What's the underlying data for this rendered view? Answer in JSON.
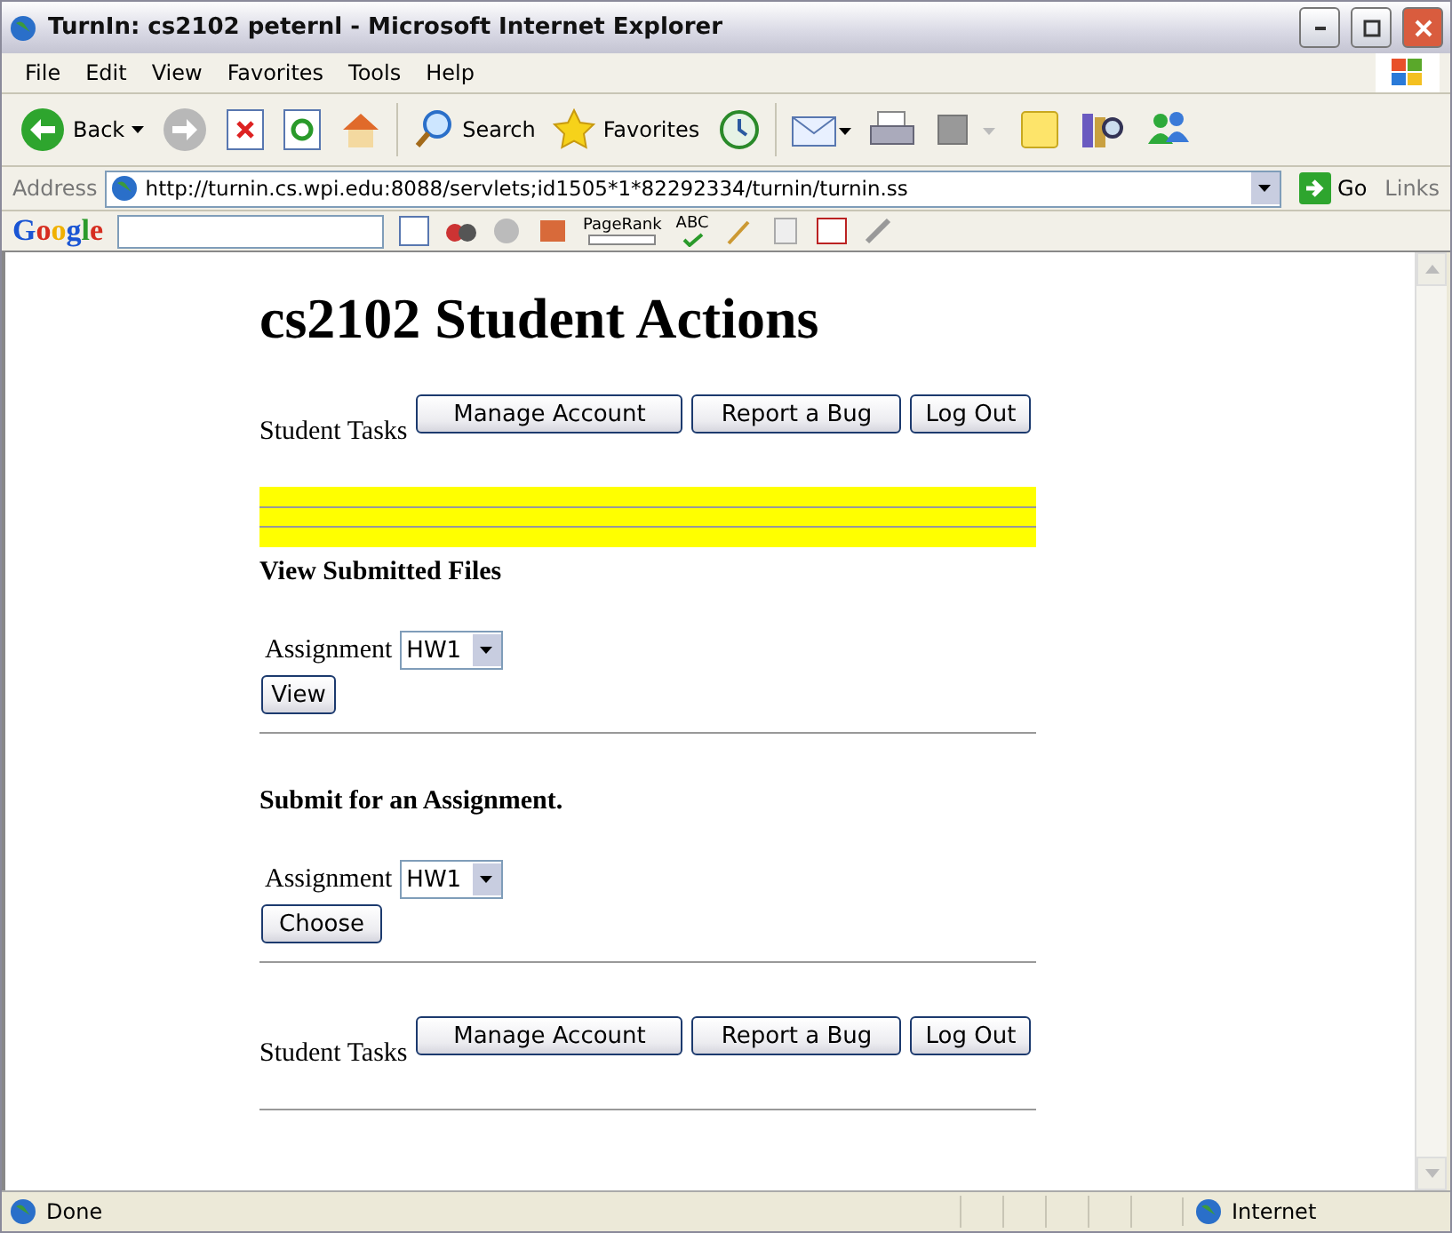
{
  "window": {
    "title": "TurnIn: cs2102 peternl - Microsoft Internet Explorer"
  },
  "menu": [
    "File",
    "Edit",
    "View",
    "Favorites",
    "Tools",
    "Help"
  ],
  "toolbar": [
    {
      "kind": "back",
      "label": "Back"
    },
    {
      "kind": "forward"
    },
    {
      "kind": "stop"
    },
    {
      "kind": "refresh"
    },
    {
      "kind": "home"
    },
    {
      "kind": "search",
      "label": "Search"
    },
    {
      "kind": "favorites",
      "label": "Favorites"
    },
    {
      "kind": "history"
    },
    {
      "kind": "mail"
    },
    {
      "kind": "print"
    },
    {
      "kind": "edit"
    },
    {
      "kind": "note"
    },
    {
      "kind": "research"
    },
    {
      "kind": "messenger"
    }
  ],
  "address_bar": {
    "label": "Address",
    "url": "http://turnin.cs.wpi.edu:8088/servlets;id1505*1*82292334/turnin/turnin.ss",
    "go": "Go",
    "links": "Links"
  },
  "google_bar": {
    "logo": "Google",
    "pagerank": "PageRank",
    "spellcheck": "ABC"
  },
  "page": {
    "heading": "cs2102 Student Actions",
    "task_bars": [
      {
        "label": "Student Tasks",
        "buttons": [
          "Manage Account",
          "Report a Bug",
          "Log Out"
        ]
      }
    ],
    "sections": [
      {
        "title": "View Submitted Files",
        "field_label": "Assignment",
        "value": "HW1",
        "button": "View"
      },
      {
        "title": "Submit for an Assignment.",
        "field_label": "Assignment",
        "value": "HW1",
        "button": "Choose"
      }
    ],
    "bottom_tasks": {
      "label": "Student Tasks",
      "buttons": [
        "Manage Account",
        "Report a Bug",
        "Log Out"
      ]
    }
  },
  "status_bar": {
    "text": "Done",
    "zone": "Internet"
  }
}
